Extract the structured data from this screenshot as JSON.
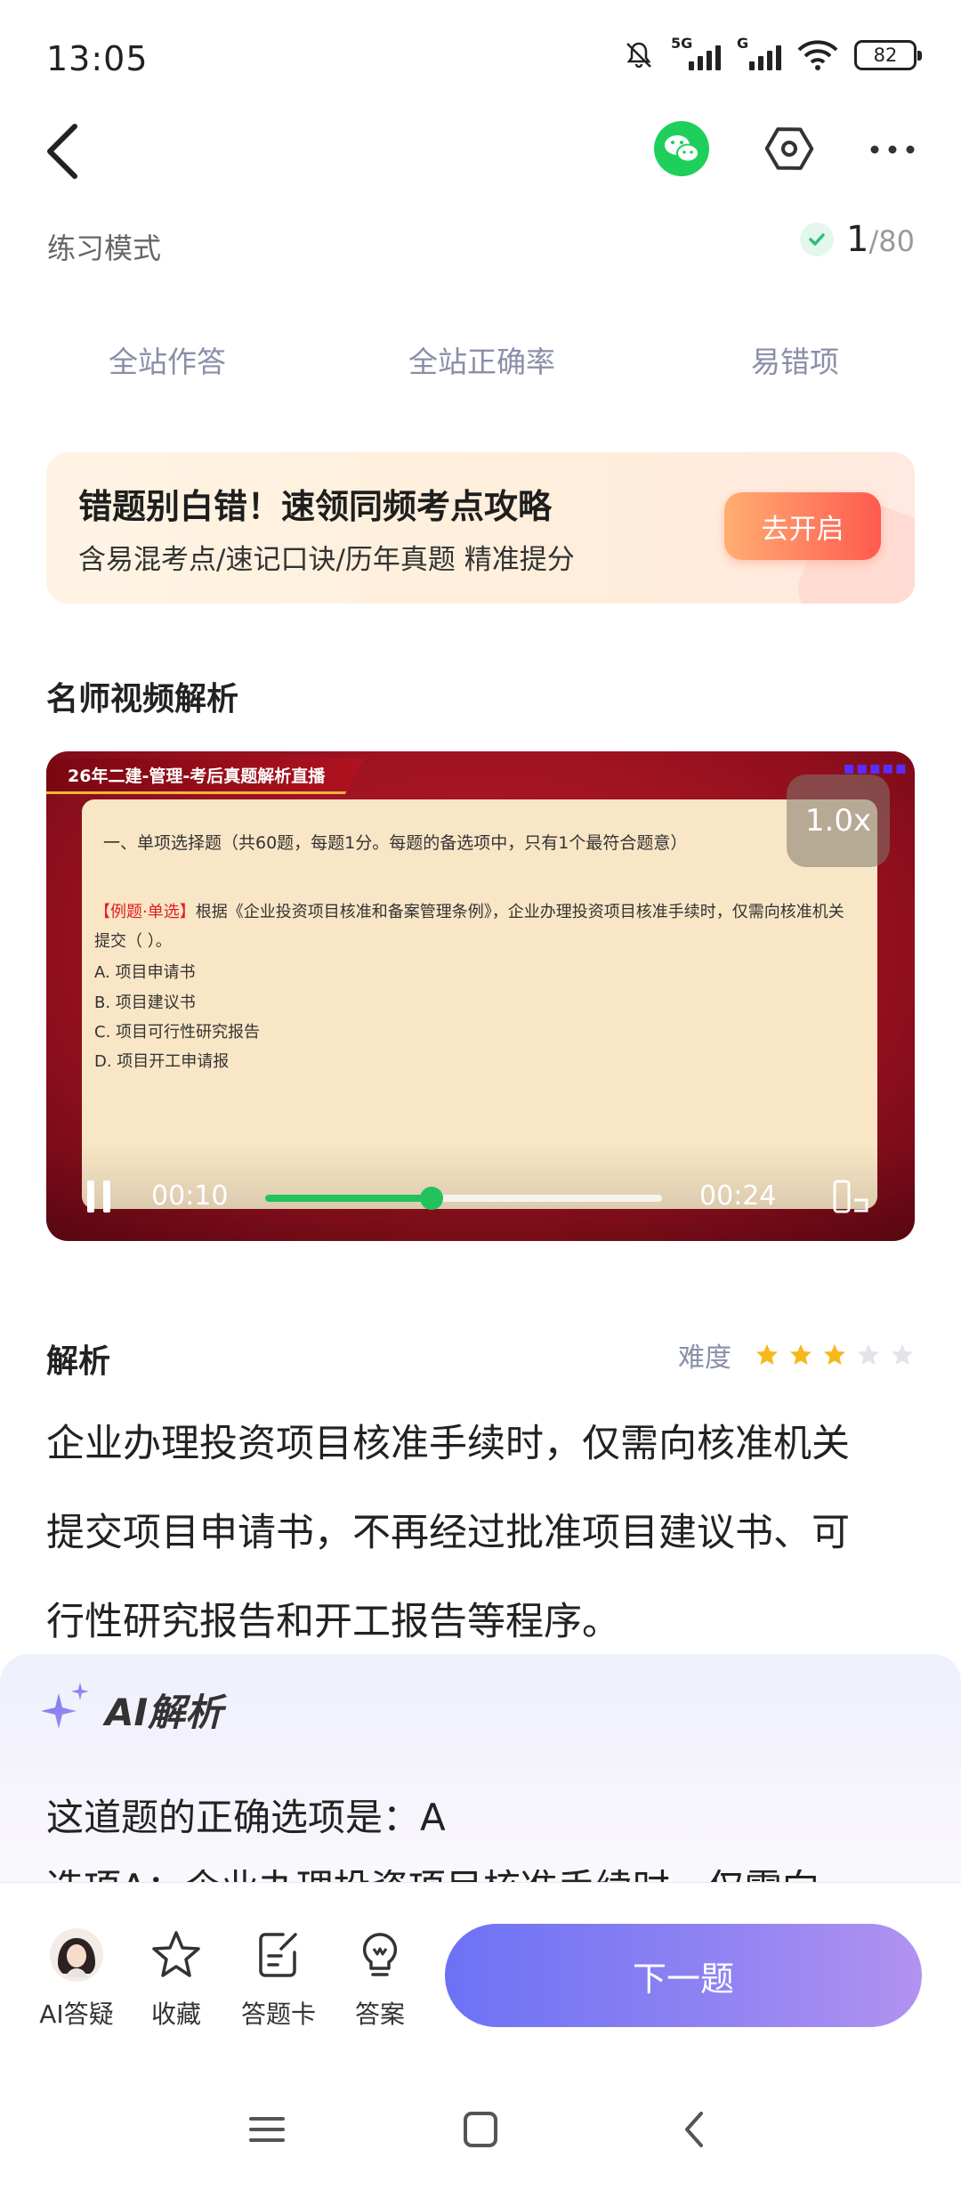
{
  "status": {
    "time": "13:05",
    "network_1": "5G",
    "network_2": "G",
    "battery": "82"
  },
  "header": {
    "back_icon": "chevron-left-icon",
    "wechat_icon": "wechat-icon",
    "settings_icon": "hexagon-settings-icon",
    "more_icon": "more-dots-icon"
  },
  "mode": {
    "label": "练习模式",
    "current": "1",
    "total": "/80"
  },
  "stats": {
    "tab1": "全站作答",
    "tab2": "全站正确率",
    "tab3": "易错项"
  },
  "banner": {
    "title": "错题别白错！速领同频考点攻略",
    "subtitle": "含易混考点/速记口诀/历年真题 精准提分",
    "button": "去开启"
  },
  "video_section": {
    "title": "名师视频解析"
  },
  "video": {
    "tag": "26年二建-管理-考后真题解析直播",
    "slide_heading": "一、单项选择题（共60题，每题1分。每题的备选项中，只有1个最符合题意）",
    "slide_tag": "【例题·单选】",
    "slide_question": "根据《企业投资项目核准和备案管理条例》，企业办理投资项目核准手续时，仅需向核准机关提交（ ）。",
    "options": [
      "A. 项目申请书",
      "B. 项目建议书",
      "C. 项目可行性研究报告",
      "D. 项目开工申请报"
    ],
    "speed": "1.0x",
    "time_current": "00:10",
    "time_total": "00:24",
    "progress": 0.42
  },
  "analysis": {
    "title": "解析",
    "difficulty_label": "难度",
    "difficulty_stars": 3,
    "difficulty_max": 5,
    "star_on_color": "#f6b81b",
    "star_off_color": "#e3e3ea",
    "line1": "企业办理投资项目核准手续时，仅需向核准机关",
    "line2": "提交项目申请书，不再经过批准项目建议书、可",
    "line3": "行性研究报告和开工报告等程序。"
  },
  "ai": {
    "title": "AI解析",
    "answer": "这道题的正确选项是：A",
    "cut_line": "选项A：企业办理投资项目核准手续时，仅需向"
  },
  "bottom_bar": {
    "ai_label": "AI答疑",
    "fav_label": "收藏",
    "card_label": "答题卡",
    "answer_label": "答案",
    "next": "下一题"
  },
  "accent": "#22c35c"
}
